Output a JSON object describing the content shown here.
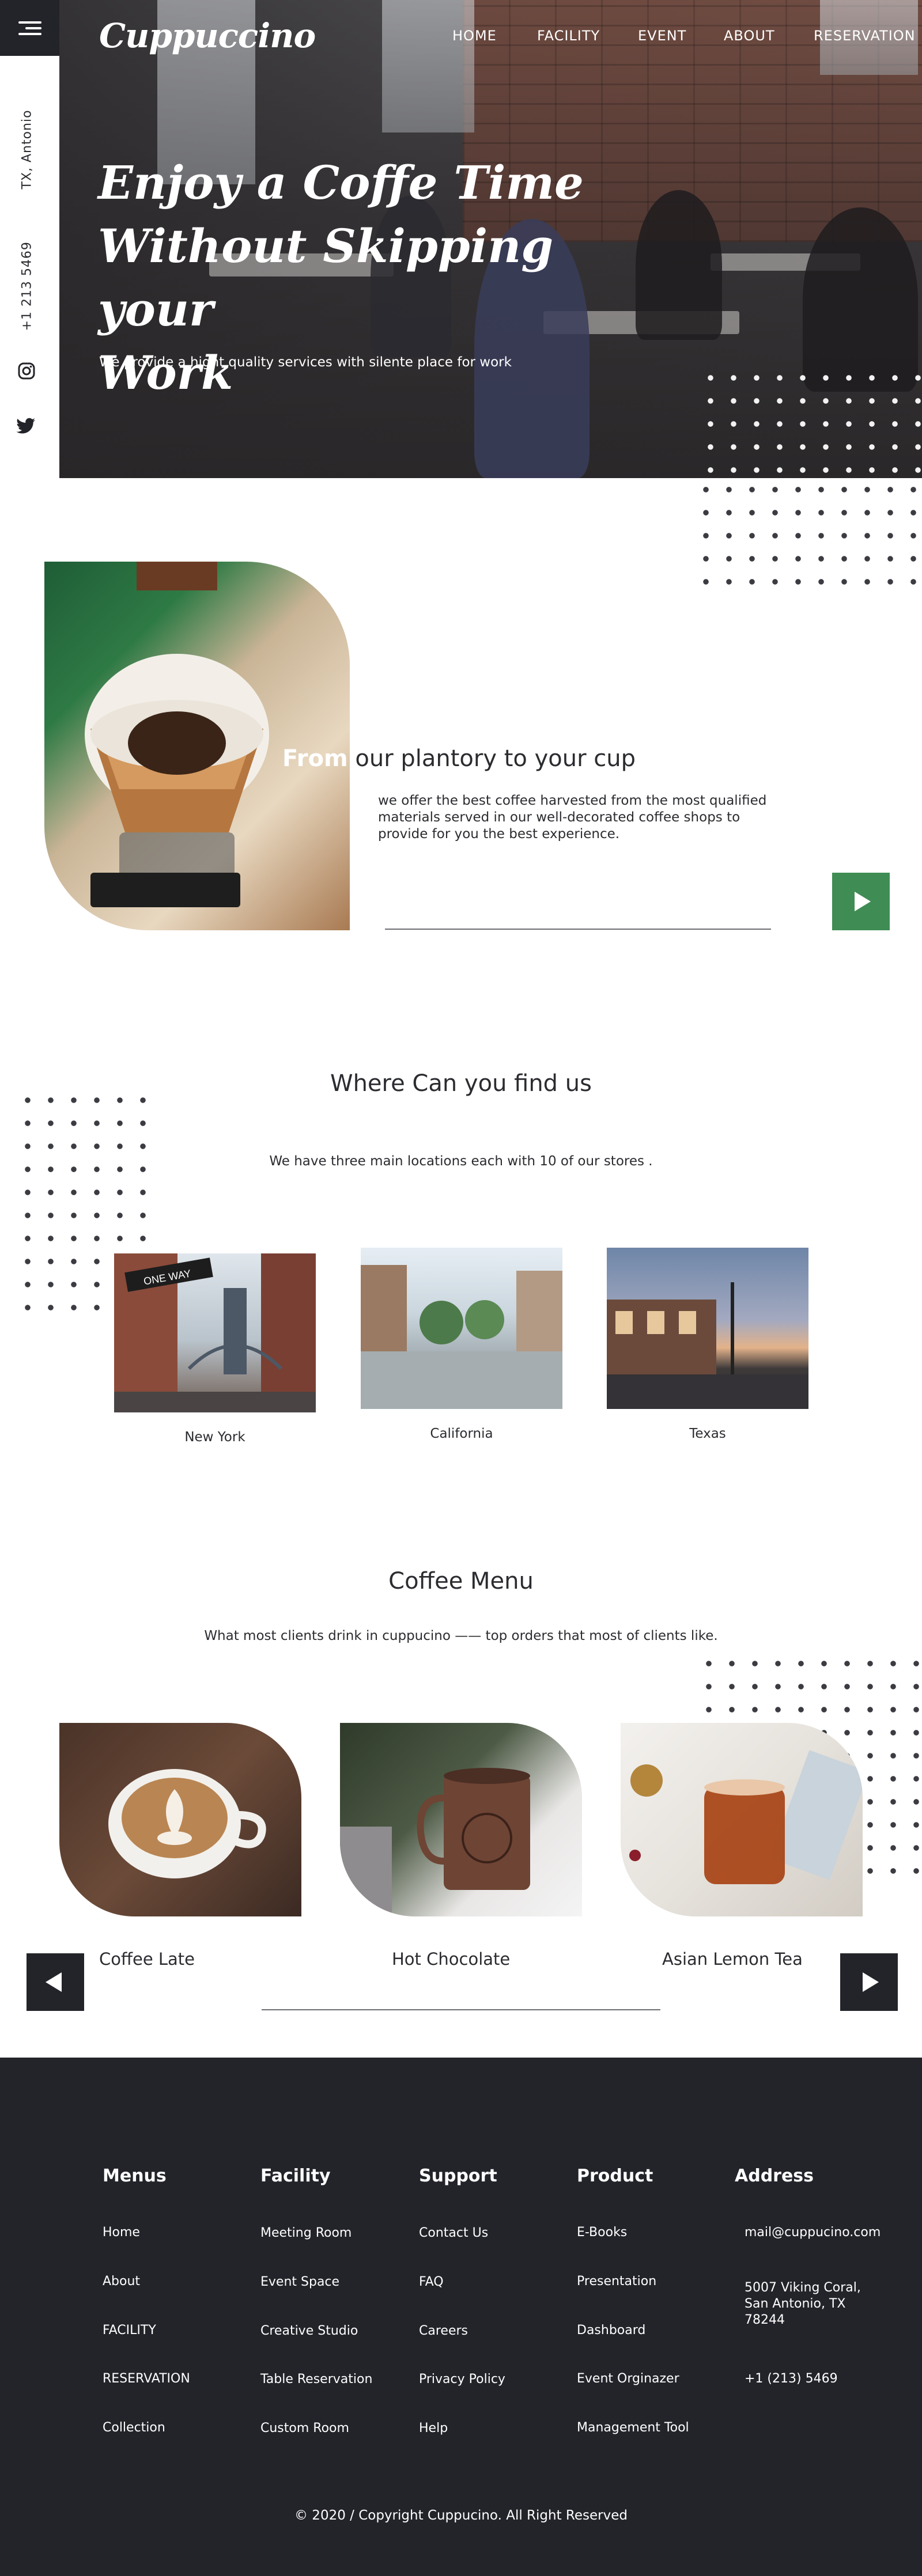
{
  "brand": "Cuppuccino",
  "nav": [
    "HOME",
    "FACILITY",
    "EVENT",
    "ABOUT",
    "RESERVATION"
  ],
  "sidebar": {
    "location": "TX, Antonio",
    "phone": "+1 213 5469",
    "icons": [
      "instagram-icon",
      "twitter-icon"
    ]
  },
  "hero": {
    "title_lines": [
      "Enjoy a Coffe Time",
      "Without Skipping your",
      "Work"
    ],
    "subtitle": "We provide a hight quality services with silente place for work"
  },
  "about": {
    "title_bold": "From",
    "title_rest": " our plantory to your cup",
    "text_lines": [
      "we offer the best coffee harvested from the most qualified",
      "materials served in our well-decorated coffee shops to",
      "provide for you the best experience."
    ]
  },
  "locations": {
    "title": "Where Can you find us",
    "subtitle": "We have three main locations each  with 10 of our stores .",
    "items": [
      {
        "name": "New York",
        "sign": "ONE WAY"
      },
      {
        "name": "California"
      },
      {
        "name": "Texas"
      }
    ]
  },
  "menu": {
    "title": "Coffee Menu",
    "subtitle": "What most clients drink in cuppucino —— top orders that most of clients like.",
    "items": [
      "Coffee Late",
      "Hot Chocolate",
      "Asian Lemon Tea"
    ]
  },
  "footer": {
    "columns": [
      {
        "heading": "Menus",
        "items": [
          "Home",
          "About",
          "FACILITY",
          "RESERVATION",
          "Collection"
        ]
      },
      {
        "heading": "Facility",
        "items": [
          "Meeting Room",
          "Event Space",
          "Creative Studio",
          "Table Reservation",
          "Custom Room"
        ]
      },
      {
        "heading": "Support",
        "items": [
          "Contact Us",
          "FAQ",
          "Careers",
          "Privacy Policy",
          "Help"
        ]
      },
      {
        "heading": "Product",
        "items": [
          "E-Books",
          "Presentation",
          "Dashboard",
          "Event Orginazer",
          "Management Tool"
        ]
      },
      {
        "heading": "Address",
        "items": [
          "mail@cuppucino.com",
          "5007 Viking Coral, San Antonio, TX 78244",
          "+1 (213) 5469"
        ]
      }
    ],
    "copyright": "© 2020 / Copyright Cuppucino. All Right Reserved"
  },
  "colors": {
    "dark": "#23242a",
    "accent_green": "#3f8d54",
    "text": "#2b2c30"
  }
}
